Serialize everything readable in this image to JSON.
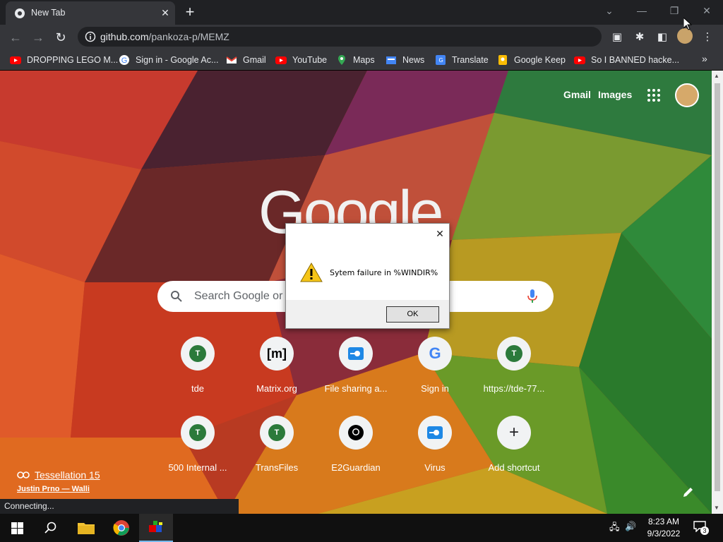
{
  "browser": {
    "tab_title": "New Tab",
    "url_host": "github.com",
    "url_path": "/pankoza-p/MEMZ"
  },
  "bookmarks": [
    {
      "label": "DROPPING LEGO M...",
      "icon": "youtube-icon"
    },
    {
      "label": "Sign in - Google Ac...",
      "icon": "google-icon"
    },
    {
      "label": "Gmail",
      "icon": "gmail-icon"
    },
    {
      "label": "YouTube",
      "icon": "youtube-icon"
    },
    {
      "label": "Maps",
      "icon": "maps-icon"
    },
    {
      "label": "News",
      "icon": "news-icon"
    },
    {
      "label": "Translate",
      "icon": "translate-icon"
    },
    {
      "label": "Google Keep",
      "icon": "keep-icon"
    },
    {
      "label": "So I BANNED hacke...",
      "icon": "youtube-icon"
    }
  ],
  "ntp": {
    "links": {
      "gmail": "Gmail",
      "images": "Images"
    },
    "logo": "Google",
    "search_placeholder": "Search Google or t",
    "shortcuts": [
      {
        "label": "tde",
        "icon": "T"
      },
      {
        "label": "Matrix.org",
        "icon": "[m]"
      },
      {
        "label": "File sharing a...",
        "icon": "file-share-icon"
      },
      {
        "label": "Sign in",
        "icon": "G"
      },
      {
        "label": "https://tde-77...",
        "icon": "T"
      },
      {
        "label": "500 Internal ...",
        "icon": "T"
      },
      {
        "label": "TransFiles",
        "icon": "T"
      },
      {
        "label": "E2Guardian",
        "icon": "github-icon"
      },
      {
        "label": "Virus",
        "icon": "file-share-icon"
      },
      {
        "label": "Add shortcut",
        "icon": "+"
      }
    ],
    "credit_title": "Tessellation 15",
    "credit_author": "Justin Prno — Walli"
  },
  "status_text": "Connecting...",
  "dialog": {
    "message": "Sytem failure in %WINDIR%",
    "ok_label": "OK"
  },
  "taskbar": {
    "time": "8:23 AM",
    "date": "9/3/2022",
    "notifications": "3"
  },
  "colors": {
    "chrome_dark": "#202124",
    "chrome_toolbar": "#35363a",
    "shortcut_green": "#2b7a3b",
    "taskbar_bg": "#101010"
  }
}
